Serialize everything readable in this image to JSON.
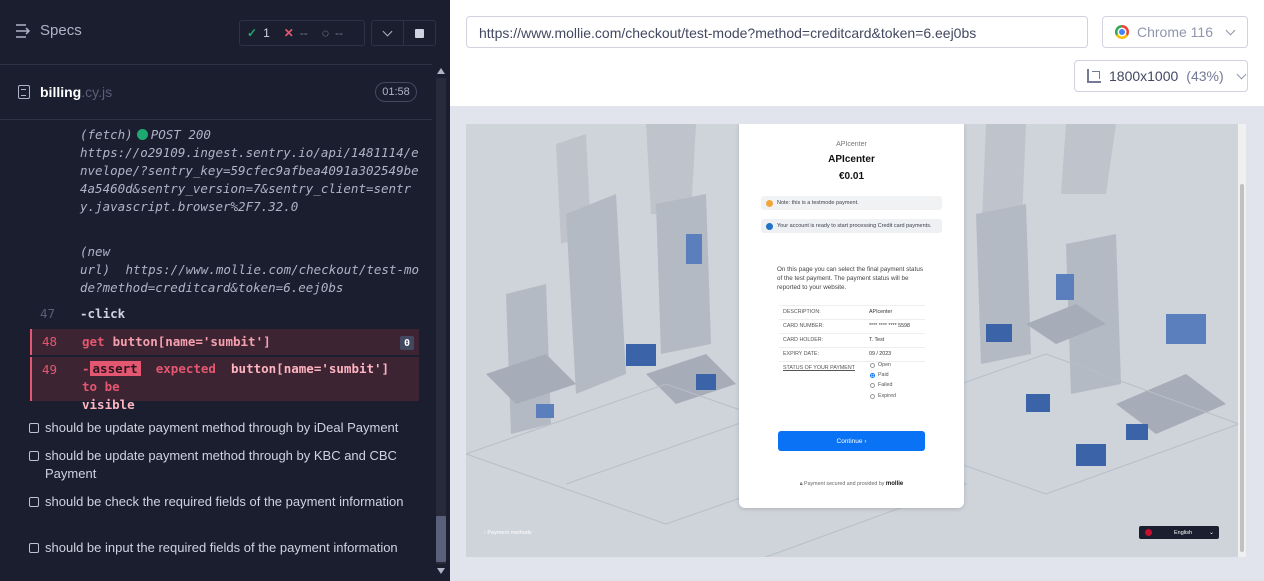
{
  "header": {
    "title": "Specs",
    "stats": {
      "passed": "1",
      "failed": "--",
      "pending": "--"
    }
  },
  "file": {
    "name": "billing",
    "ext": ".cy.js",
    "duration": "01:58"
  },
  "log": {
    "fetch_type": "(fetch)",
    "fetch_method": "POST 200",
    "fetch_url": "https://o29109.ingest.sentry.io/api/1481114/envelope/?sentry_key=59cfec9afbea4091a302549be4a5460d&sentry_version=7&sentry_client=sentry.javascript.browser%2F7.32.0",
    "newurl_type": "(new url)",
    "newurl_url": "https://www.mollie.com/checkout/test-mode?method=creditcard&token=6.eej0bs",
    "commands": [
      {
        "num": "47",
        "name": "-click",
        "arg": ""
      },
      {
        "num": "48",
        "name": "get",
        "arg": "button[name='sumbit']",
        "badge": "0"
      }
    ],
    "assertion": {
      "num": "49",
      "prefix": "-",
      "keyword": "assert",
      "expected": "expected",
      "subject": "button[name='sumbit']",
      "to_be": "to be",
      "visible": "visible"
    }
  },
  "tests": [
    "should be update payment method through by iDeal Payment",
    "should be update payment method through by KBC and CBC Payment",
    "should be check the required fields of the payment information",
    "should be input the required fields of the payment information"
  ],
  "browser": {
    "url": "https://www.mollie.com/checkout/test-mode?method=creditcard&token=6.eej0bs",
    "name": "Chrome 116",
    "viewport": "1800x1000",
    "zoom": "(43%)"
  },
  "checkout": {
    "merchant_small": "APIcenter",
    "merchant": "APIcenter",
    "amount": "€0.01",
    "note_testmode": "Note: this is a testmode payment.",
    "note_ready": "Your account is ready to start processing Credit card payments.",
    "info": "On this page you can select the final payment status of the test payment. The payment status will be reported to your website.",
    "details": [
      {
        "k": "DESCRIPTION:",
        "v": "APIcenter"
      },
      {
        "k": "CARD NUMBER:",
        "v": "**** **** **** 5598"
      },
      {
        "k": "CARD HOLDER:",
        "v": "T. Test"
      },
      {
        "k": "EXPIRY DATE:",
        "v": "09 / 2023"
      }
    ],
    "status_label": "STATUS OF YOUR PAYMENT",
    "status_options": [
      "Open",
      "Paid",
      "Failed",
      "Expired"
    ],
    "selected_status": "Paid",
    "continue": "Continue ›",
    "secured": "Payment secured and provided by",
    "secured_brand": "mollie",
    "back": "‹ Payment methods",
    "language": "English"
  }
}
